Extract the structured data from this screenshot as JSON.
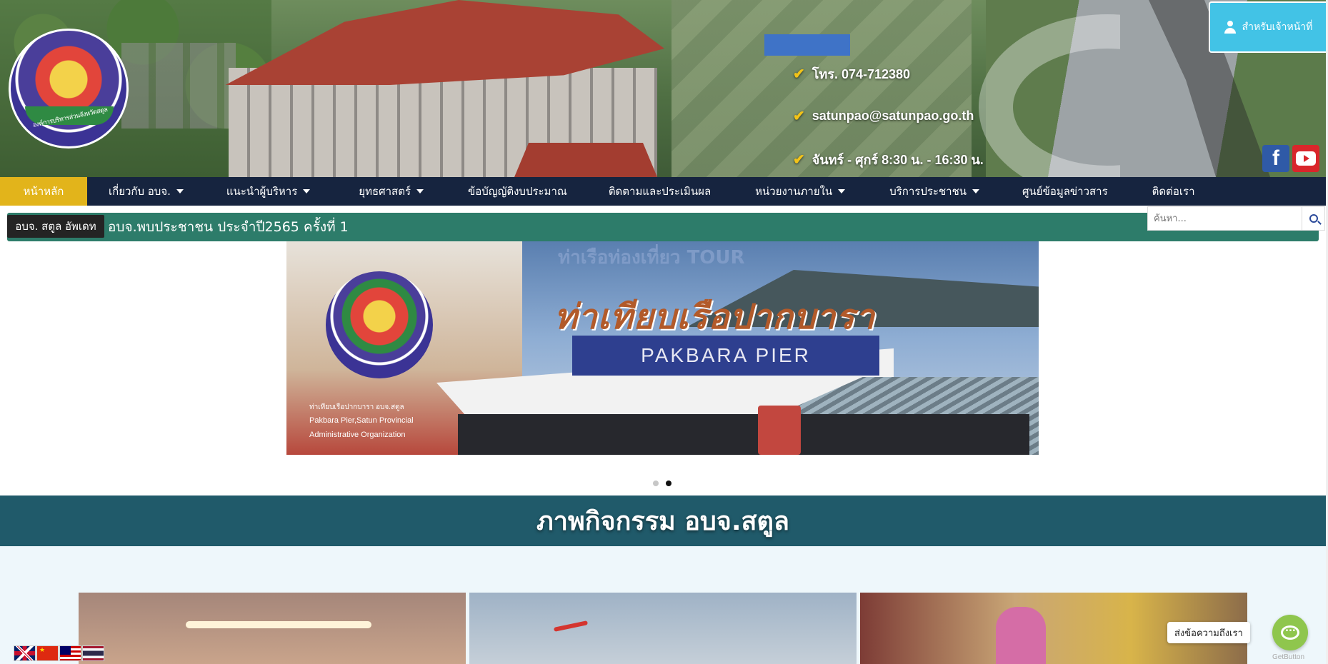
{
  "header": {
    "logo_alt": "องค์การบริหารส่วนจังหวัดสตูล",
    "contact": {
      "phone": "โทร. 074-712380",
      "email": "satunpao@satunpao.go.th",
      "hours": "จันทร์ - ศุกร์ 8:30 น. - 16:30 น."
    },
    "staff_button": "สำหรับเจ้าหน้าที่",
    "social": [
      "facebook-icon",
      "youtube-icon"
    ],
    "facebook_glyph": "f"
  },
  "nav": {
    "items": [
      {
        "label": "หน้าหลัก",
        "active": true,
        "dropdown": false
      },
      {
        "label": "เกี่ยวกับ อบจ.",
        "dropdown": true
      },
      {
        "label": "แนะนำผู้บริหาร",
        "dropdown": true
      },
      {
        "label": "ยุทธศาสตร์",
        "dropdown": true
      },
      {
        "label": "ข้อบัญญัติงบประมาณ",
        "dropdown": false
      },
      {
        "label": "ติดตามและประเมินผล",
        "dropdown": false
      },
      {
        "label": "หน่วยงานภายใน",
        "dropdown": true
      },
      {
        "label": "บริการประชาชน",
        "dropdown": true
      },
      {
        "label": "ศูนย์ข้อมูลข่าวสาร",
        "dropdown": false
      },
      {
        "label": "ติดต่อเรา",
        "dropdown": false
      }
    ]
  },
  "ticker": {
    "label": "อบจ. สตูล อัพเดท",
    "text": "อบจ.พบประชาชน ประจำปี2565 ครั้งที่ 1"
  },
  "search": {
    "placeholder": "ค้นหา..."
  },
  "slider": {
    "sign_top": "ท่าเรือท่องเที่ยว TOUR",
    "title_th": "ท่าเทียบเรือปากบารา",
    "title_en": "PAKBARA PIER",
    "caption_th": "ท่าเทียบเรือปากบารา อบจ.สตูล",
    "caption_en_1": "Pakbara Pier,Satun Provincial",
    "caption_en_2": "Administrative Organization",
    "slides_count": 2,
    "active_slide": 2
  },
  "activities": {
    "title": "ภาพกิจกรรม อบจ.สตูล"
  },
  "languages": [
    "English",
    "Chinese",
    "Malay",
    "Thai"
  ],
  "chat": {
    "label": "ส่งข้อความถึงเรา",
    "brand": "GetButton"
  },
  "colors": {
    "nav_bg": "#16243f",
    "nav_active": "#e2b41b",
    "ticker_bg": "#2d7c6a",
    "activity_band": "#205a6a",
    "staff_button": "#42c3e6",
    "check": "#f2c318"
  }
}
